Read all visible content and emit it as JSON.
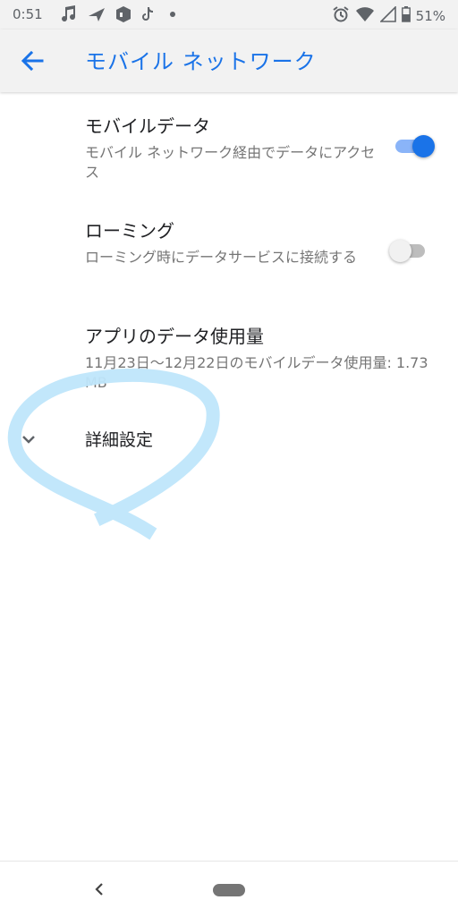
{
  "status_bar": {
    "time": "0:51",
    "battery": "51%",
    "notification_icons": [
      "music-note-icon",
      "paper-plane-icon",
      "app-logo-icon",
      "tiktok-icon",
      "more-dot-icon"
    ],
    "system_icons": [
      "alarm-icon",
      "wifi-icon",
      "signal-icon",
      "battery-icon"
    ]
  },
  "app_bar": {
    "title": "モバイル ネットワーク",
    "back_icon": "arrow-back-icon"
  },
  "settings": [
    {
      "title": "モバイルデータ",
      "summary": "モバイル ネットワーク経由でデータにアクセス",
      "toggle": true
    },
    {
      "title": "ローミング",
      "summary": "ローミング時にデータサービスに接続する",
      "toggle": false
    },
    {
      "title": "アプリのデータ使用量",
      "summary": "11月23日〜12月22日のモバイルデータ使用量: 1.73 MB"
    }
  ],
  "advanced": {
    "label": "詳細設定",
    "icon": "chevron-down-icon"
  },
  "nav_bar": {
    "back_icon": "nav-back-icon",
    "home_icon": "home-pill-icon"
  },
  "colors": {
    "accent": "#1a73e8",
    "accent_track": "#8ab4f8",
    "toggle_off_thumb": "#f1f1f1",
    "toggle_off_track": "#bdbdbd",
    "status_bar_bg": "#f2f2f2",
    "summary_text": "#757575",
    "annotation_stroke": "#bfe6fb"
  }
}
